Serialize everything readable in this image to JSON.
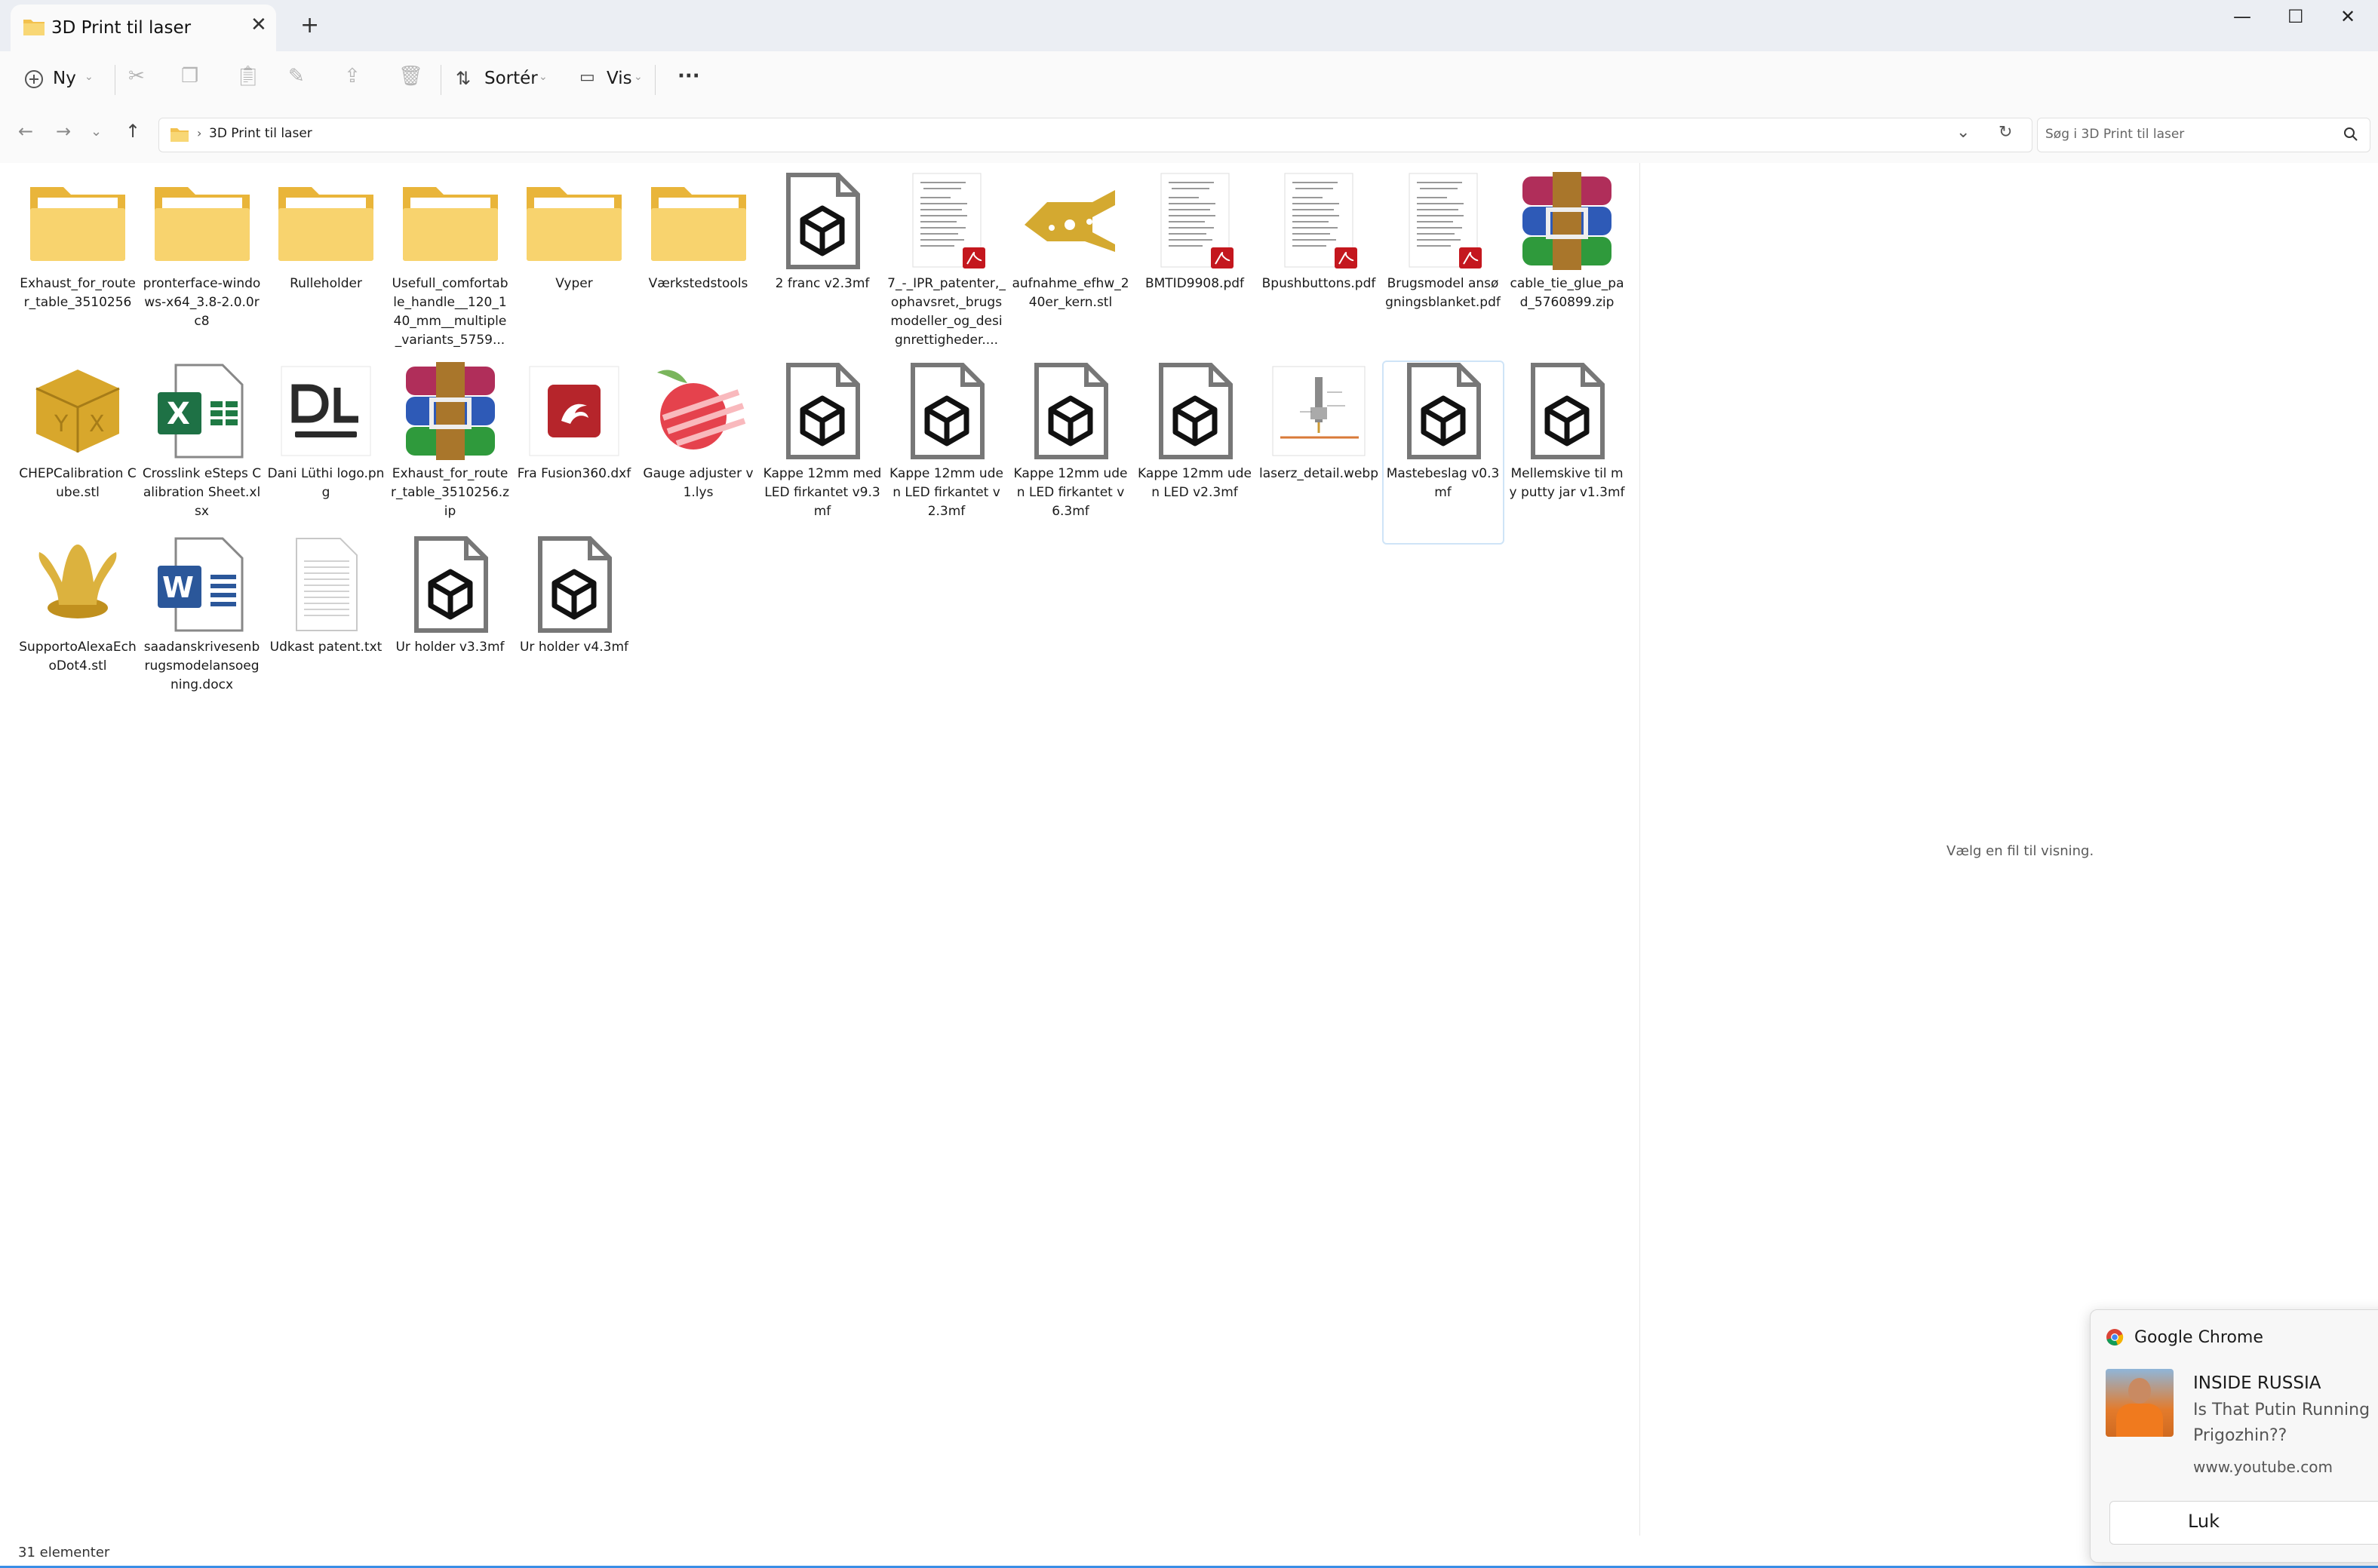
{
  "window": {
    "tab_title": "3D Print til laser",
    "new_tab": "+",
    "close_tab": "✕",
    "minimize": "—",
    "maximize": "☐",
    "close": "✕"
  },
  "toolbar": {
    "new_label": "Ny",
    "sort_label": "Sortér",
    "view_label": "Vis",
    "more_label": "···"
  },
  "address": {
    "crumb": "3D Print til laser",
    "search_placeholder": "Søg i 3D Print til laser"
  },
  "files": [
    {
      "name": "Exhaust_for_router_table_3510256",
      "icon": "folder"
    },
    {
      "name": "pronterface-windows-x64_3.8-2.0.0rc8",
      "icon": "folder"
    },
    {
      "name": "Rulleholder",
      "icon": "folder"
    },
    {
      "name": "Usefull_comfortable_handle__120_140_mm__multiple_variants_5759...",
      "icon": "folder"
    },
    {
      "name": "Vyper",
      "icon": "folder"
    },
    {
      "name": "Værkstedstools",
      "icon": "folder"
    },
    {
      "name": "2 franc v2.3mf",
      "icon": "3mf"
    },
    {
      "name": "7_-_IPR_patenter,_ophavsret,_brugsmodeller_og_designrettigheder....",
      "icon": "pdf"
    },
    {
      "name": "aufnahme_efhw_240er_kern.stl",
      "icon": "stl-part"
    },
    {
      "name": "BMTID9908.pdf",
      "icon": "pdf"
    },
    {
      "name": "Bpushbuttons.pdf",
      "icon": "pdf"
    },
    {
      "name": "Brugsmodel ansøgningsblanket.pdf",
      "icon": "pdf"
    },
    {
      "name": "cable_tie_glue_pad_5760899.zip",
      "icon": "archive"
    },
    {
      "name": "CHEPCalibration Cube.stl",
      "icon": "stl-cube"
    },
    {
      "name": "Crosslink eSteps Calibration Sheet.xlsx",
      "icon": "excel"
    },
    {
      "name": "Dani Lüthi logo.png",
      "icon": "logo"
    },
    {
      "name": "Exhaust_for_router_table_3510256.zip",
      "icon": "archive"
    },
    {
      "name": "Fra Fusion360.dxf",
      "icon": "dxf"
    },
    {
      "name": "Gauge adjuster v1.lys",
      "icon": "lys"
    },
    {
      "name": "Kappe 12mm med LED firkantet v9.3mf",
      "icon": "3mf"
    },
    {
      "name": "Kappe 12mm uden LED firkantet v2.3mf",
      "icon": "3mf"
    },
    {
      "name": "Kappe 12mm uden LED firkantet v6.3mf",
      "icon": "3mf"
    },
    {
      "name": "Kappe 12mm uden LED v2.3mf",
      "icon": "3mf"
    },
    {
      "name": "laserz_detail.webp",
      "icon": "image"
    },
    {
      "name": "Mastebeslag v0.3mf",
      "icon": "3mf"
    },
    {
      "name": "Mellemskive til my putty jar v1.3mf",
      "icon": "3mf"
    },
    {
      "name": "SupportoAlexaEchoDot4.stl",
      "icon": "stl-support"
    },
    {
      "name": "saadanskrivesenbrugsmodelansoegning.docx",
      "icon": "word"
    },
    {
      "name": "Udkast patent.txt",
      "icon": "text"
    },
    {
      "name": "Ur holder v3.3mf",
      "icon": "3mf"
    },
    {
      "name": "Ur holder v4.3mf",
      "icon": "3mf"
    }
  ],
  "preview": {
    "message": "Vælg en fil til visning."
  },
  "status": {
    "count": "31 elementer"
  },
  "toast": {
    "app": "Google Chrome",
    "title": "INSIDE RUSSIA",
    "body": "Is That Putin Running Prigozhin??",
    "source": "www.youtube.com",
    "button": "Luk"
  }
}
